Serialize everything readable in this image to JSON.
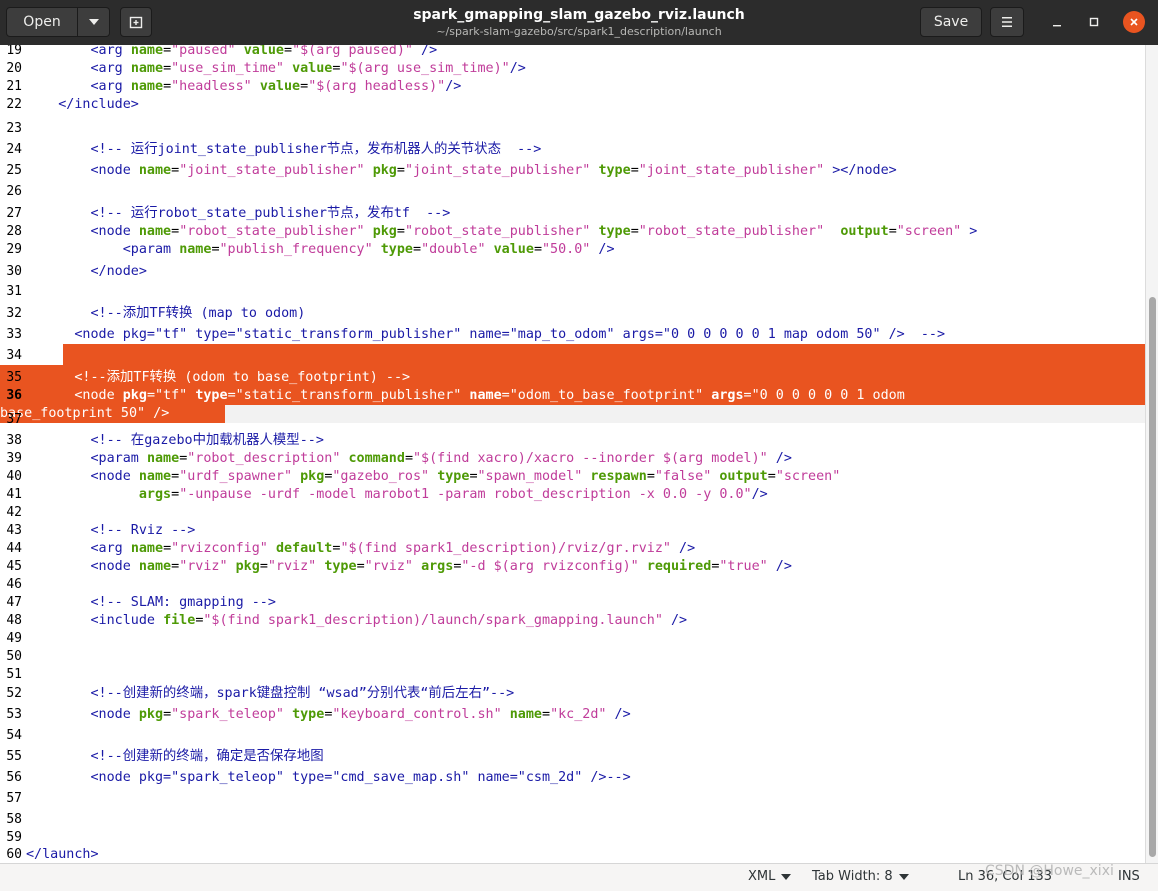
{
  "header": {
    "open_label": "Open",
    "title": "spark_gmapping_slam_gazebo_rviz.launch",
    "subtitle": "~/spark-slam-gazebo/src/spark1_description/launch",
    "save_label": "Save",
    "icons": {
      "open_dropdown": "chevron-down-icon",
      "new_tab": "new-document-icon",
      "menu": "hamburger-menu-icon",
      "minimize": "minimize-icon",
      "maximize": "maximize-icon",
      "close": "close-icon"
    },
    "accent": "#e95420"
  },
  "editor": {
    "current_line": "36",
    "highlight_color": "#e95420",
    "lines": [
      {
        "n": "19",
        "segments": [
          [
            "t",
            "        "
          ],
          [
            "tg",
            "<arg "
          ],
          [
            "at",
            "name"
          ],
          [
            "eq",
            "="
          ],
          [
            "st",
            "\"paused\""
          ],
          [
            "t",
            " "
          ],
          [
            "at",
            "value"
          ],
          [
            "eq",
            "="
          ],
          [
            "st",
            "\"$(arg paused)\""
          ],
          [
            "tg",
            " />"
          ]
        ]
      },
      {
        "n": "20",
        "segments": [
          [
            "t",
            "        "
          ],
          [
            "tg",
            "<arg "
          ],
          [
            "at",
            "name"
          ],
          [
            "eq",
            "="
          ],
          [
            "st",
            "\"use_sim_time\""
          ],
          [
            "t",
            " "
          ],
          [
            "at",
            "value"
          ],
          [
            "eq",
            "="
          ],
          [
            "st",
            "\"$(arg use_sim_time)\""
          ],
          [
            "tg",
            "/>"
          ]
        ]
      },
      {
        "n": "21",
        "segments": [
          [
            "t",
            "        "
          ],
          [
            "tg",
            "<arg "
          ],
          [
            "at",
            "name"
          ],
          [
            "eq",
            "="
          ],
          [
            "st",
            "\"headless\""
          ],
          [
            "t",
            " "
          ],
          [
            "at",
            "value"
          ],
          [
            "eq",
            "="
          ],
          [
            "st",
            "\"$(arg headless)\""
          ],
          [
            "tg",
            "/>"
          ]
        ]
      },
      {
        "n": "22",
        "segments": [
          [
            "t",
            "    "
          ],
          [
            "tg",
            "</include>"
          ]
        ]
      },
      {
        "n": "23",
        "segments": []
      },
      {
        "n": "24",
        "segments": [
          [
            "t",
            "        "
          ],
          [
            "cm",
            "<!-- 运行joint_state_publisher节点，发布机器人的关节状态  -->"
          ]
        ]
      },
      {
        "n": "25",
        "segments": [
          [
            "t",
            "        "
          ],
          [
            "tg",
            "<node "
          ],
          [
            "at",
            "name"
          ],
          [
            "eq",
            "="
          ],
          [
            "st",
            "\"joint_state_publisher\""
          ],
          [
            "t",
            " "
          ],
          [
            "at",
            "pkg"
          ],
          [
            "eq",
            "="
          ],
          [
            "st",
            "\"joint_state_publisher\""
          ],
          [
            "t",
            " "
          ],
          [
            "at",
            "type"
          ],
          [
            "eq",
            "="
          ],
          [
            "st",
            "\"joint_state_publisher\""
          ],
          [
            "tg",
            " ></node>"
          ]
        ]
      },
      {
        "n": "26",
        "segments": []
      },
      {
        "n": "27",
        "segments": [
          [
            "t",
            "        "
          ],
          [
            "cm",
            "<!-- 运行robot_state_publisher节点，发布tf  -->"
          ]
        ]
      },
      {
        "n": "28",
        "segments": [
          [
            "t",
            "        "
          ],
          [
            "tg",
            "<node "
          ],
          [
            "at",
            "name"
          ],
          [
            "eq",
            "="
          ],
          [
            "st",
            "\"robot_state_publisher\""
          ],
          [
            "t",
            " "
          ],
          [
            "at",
            "pkg"
          ],
          [
            "eq",
            "="
          ],
          [
            "st",
            "\"robot_state_publisher\""
          ],
          [
            "t",
            " "
          ],
          [
            "at",
            "type"
          ],
          [
            "eq",
            "="
          ],
          [
            "st",
            "\"robot_state_publisher\""
          ],
          [
            "t",
            "  "
          ],
          [
            "at",
            "output"
          ],
          [
            "eq",
            "="
          ],
          [
            "st",
            "\"screen\""
          ],
          [
            "tg",
            " >"
          ]
        ]
      },
      {
        "n": "29",
        "segments": [
          [
            "t",
            "            "
          ],
          [
            "tg",
            "<param "
          ],
          [
            "at",
            "name"
          ],
          [
            "eq",
            "="
          ],
          [
            "st",
            "\"publish_frequency\""
          ],
          [
            "t",
            " "
          ],
          [
            "at",
            "type"
          ],
          [
            "eq",
            "="
          ],
          [
            "st",
            "\"double\""
          ],
          [
            "t",
            " "
          ],
          [
            "at",
            "value"
          ],
          [
            "eq",
            "="
          ],
          [
            "st",
            "\"50.0\""
          ],
          [
            "tg",
            " />"
          ]
        ]
      },
      {
        "n": "30",
        "segments": [
          [
            "t",
            "        "
          ],
          [
            "tg",
            "</node>"
          ]
        ]
      },
      {
        "n": "31",
        "segments": []
      },
      {
        "n": "32",
        "segments": [
          [
            "t",
            "        "
          ],
          [
            "cm",
            "<!--添加TF转换 (map to odom)"
          ]
        ]
      },
      {
        "n": "33",
        "segments": [
          [
            "cm",
            "      <node pkg=\"tf\" type=\"static_transform_publisher\" name=\"map_to_odom\" args=\"0 0 0 0 0 0 1 map odom 50\" />  -->"
          ]
        ]
      },
      {
        "n": "34",
        "segments": [],
        "hl": "partial"
      },
      {
        "n": "35",
        "segments": [
          [
            "t",
            "      "
          ],
          [
            "cm",
            "<!--添加TF转换 (odom to base_footprint) -->"
          ]
        ],
        "hl": "full"
      },
      {
        "n": "36",
        "segments": [
          [
            "t",
            "      "
          ],
          [
            "tg",
            "<node "
          ],
          [
            "at",
            "pkg"
          ],
          [
            "eq",
            "="
          ],
          [
            "st",
            "\"tf\""
          ],
          [
            "t",
            " "
          ],
          [
            "at",
            "type"
          ],
          [
            "eq",
            "="
          ],
          [
            "st",
            "\"static_transform_publisher\""
          ],
          [
            "t",
            " "
          ],
          [
            "at",
            "name"
          ],
          [
            "eq",
            "="
          ],
          [
            "st",
            "\"odom_to_base_footprint\""
          ],
          [
            "t",
            " "
          ],
          [
            "at",
            "args"
          ],
          [
            "eq",
            "="
          ],
          [
            "st",
            "\"0 0 0 0 0 0 1 odom"
          ]
        ],
        "hl": "full",
        "wrap": "base_footprint 50\" />"
      },
      {
        "n": "37",
        "segments": []
      },
      {
        "n": "38",
        "segments": [
          [
            "t",
            "        "
          ],
          [
            "cm",
            "<!-- 在gazebo中加载机器人模型-->"
          ]
        ]
      },
      {
        "n": "39",
        "segments": [
          [
            "t",
            "        "
          ],
          [
            "tg",
            "<param "
          ],
          [
            "at",
            "name"
          ],
          [
            "eq",
            "="
          ],
          [
            "st",
            "\"robot_description\""
          ],
          [
            "t",
            " "
          ],
          [
            "at",
            "command"
          ],
          [
            "eq",
            "="
          ],
          [
            "st",
            "\"$(find xacro)/xacro --inorder $(arg model)\""
          ],
          [
            "tg",
            " />"
          ]
        ]
      },
      {
        "n": "40",
        "segments": [
          [
            "t",
            "        "
          ],
          [
            "tg",
            "<node "
          ],
          [
            "at",
            "name"
          ],
          [
            "eq",
            "="
          ],
          [
            "st",
            "\"urdf_spawner\""
          ],
          [
            "t",
            " "
          ],
          [
            "at",
            "pkg"
          ],
          [
            "eq",
            "="
          ],
          [
            "st",
            "\"gazebo_ros\""
          ],
          [
            "t",
            " "
          ],
          [
            "at",
            "type"
          ],
          [
            "eq",
            "="
          ],
          [
            "st",
            "\"spawn_model\""
          ],
          [
            "t",
            " "
          ],
          [
            "at",
            "respawn"
          ],
          [
            "eq",
            "="
          ],
          [
            "st",
            "\"false\""
          ],
          [
            "t",
            " "
          ],
          [
            "at",
            "output"
          ],
          [
            "eq",
            "="
          ],
          [
            "st",
            "\"screen\""
          ]
        ]
      },
      {
        "n": "41",
        "segments": [
          [
            "t",
            "              "
          ],
          [
            "at",
            "args"
          ],
          [
            "eq",
            "="
          ],
          [
            "st",
            "\"-unpause -urdf -model marobot1 -param robot_description -x 0.0 -y 0.0\""
          ],
          [
            "tg",
            "/>"
          ]
        ]
      },
      {
        "n": "42",
        "segments": []
      },
      {
        "n": "43",
        "segments": [
          [
            "t",
            "        "
          ],
          [
            "cm",
            "<!-- Rviz -->"
          ]
        ]
      },
      {
        "n": "44",
        "segments": [
          [
            "t",
            "        "
          ],
          [
            "tg",
            "<arg "
          ],
          [
            "at",
            "name"
          ],
          [
            "eq",
            "="
          ],
          [
            "st",
            "\"rvizconfig\""
          ],
          [
            "t",
            " "
          ],
          [
            "at",
            "default"
          ],
          [
            "eq",
            "="
          ],
          [
            "st",
            "\"$(find spark1_description)/rviz/gr.rviz\""
          ],
          [
            "tg",
            " />"
          ]
        ]
      },
      {
        "n": "45",
        "segments": [
          [
            "t",
            "        "
          ],
          [
            "tg",
            "<node "
          ],
          [
            "at",
            "name"
          ],
          [
            "eq",
            "="
          ],
          [
            "st",
            "\"rviz\""
          ],
          [
            "t",
            " "
          ],
          [
            "at",
            "pkg"
          ],
          [
            "eq",
            "="
          ],
          [
            "st",
            "\"rviz\""
          ],
          [
            "t",
            " "
          ],
          [
            "at",
            "type"
          ],
          [
            "eq",
            "="
          ],
          [
            "st",
            "\"rviz\""
          ],
          [
            "t",
            " "
          ],
          [
            "at",
            "args"
          ],
          [
            "eq",
            "="
          ],
          [
            "st",
            "\"-d $(arg rvizconfig)\""
          ],
          [
            "t",
            " "
          ],
          [
            "at",
            "required"
          ],
          [
            "eq",
            "="
          ],
          [
            "st",
            "\"true\""
          ],
          [
            "tg",
            " />"
          ]
        ]
      },
      {
        "n": "46",
        "segments": []
      },
      {
        "n": "47",
        "segments": [
          [
            "t",
            "        "
          ],
          [
            "cm",
            "<!-- SLAM: gmapping -->"
          ]
        ]
      },
      {
        "n": "48",
        "segments": [
          [
            "t",
            "        "
          ],
          [
            "tg",
            "<include "
          ],
          [
            "at",
            "file"
          ],
          [
            "eq",
            "="
          ],
          [
            "st",
            "\"$(find spark1_description)/launch/spark_gmapping.launch\""
          ],
          [
            "tg",
            " />"
          ]
        ]
      },
      {
        "n": "49",
        "segments": []
      },
      {
        "n": "50",
        "segments": []
      },
      {
        "n": "51",
        "segments": []
      },
      {
        "n": "52",
        "segments": [
          [
            "t",
            "        "
          ],
          [
            "cm",
            "<!--创建新的终端，spark键盘控制 “wsad”分别代表“前后左右”-->"
          ]
        ]
      },
      {
        "n": "53",
        "segments": [
          [
            "t",
            "        "
          ],
          [
            "tg",
            "<node "
          ],
          [
            "at",
            "pkg"
          ],
          [
            "eq",
            "="
          ],
          [
            "st",
            "\"spark_teleop\""
          ],
          [
            "t",
            " "
          ],
          [
            "at",
            "type"
          ],
          [
            "eq",
            "="
          ],
          [
            "st",
            "\"keyboard_control.sh\""
          ],
          [
            "t",
            " "
          ],
          [
            "at",
            "name"
          ],
          [
            "eq",
            "="
          ],
          [
            "st",
            "\"kc_2d\""
          ],
          [
            "tg",
            " />"
          ]
        ]
      },
      {
        "n": "54",
        "segments": []
      },
      {
        "n": "55",
        "segments": [
          [
            "t",
            "        "
          ],
          [
            "cm",
            "<!--创建新的终端，确定是否保存地图"
          ]
        ]
      },
      {
        "n": "56",
        "segments": [
          [
            "cm",
            "        <node pkg=\"spark_teleop\" type=\"cmd_save_map.sh\" name=\"csm_2d\" />-->"
          ]
        ]
      },
      {
        "n": "57",
        "segments": []
      },
      {
        "n": "58",
        "segments": []
      },
      {
        "n": "59",
        "segments": []
      },
      {
        "n": "60",
        "segments": [
          [
            "tg",
            "</launch>"
          ]
        ]
      }
    ]
  },
  "statusbar": {
    "language": "XML",
    "tab_width": "Tab Width: 8",
    "position": "Ln 36, Col 133",
    "mode": "INS"
  },
  "watermark": "CSDN @Howe_xixi"
}
